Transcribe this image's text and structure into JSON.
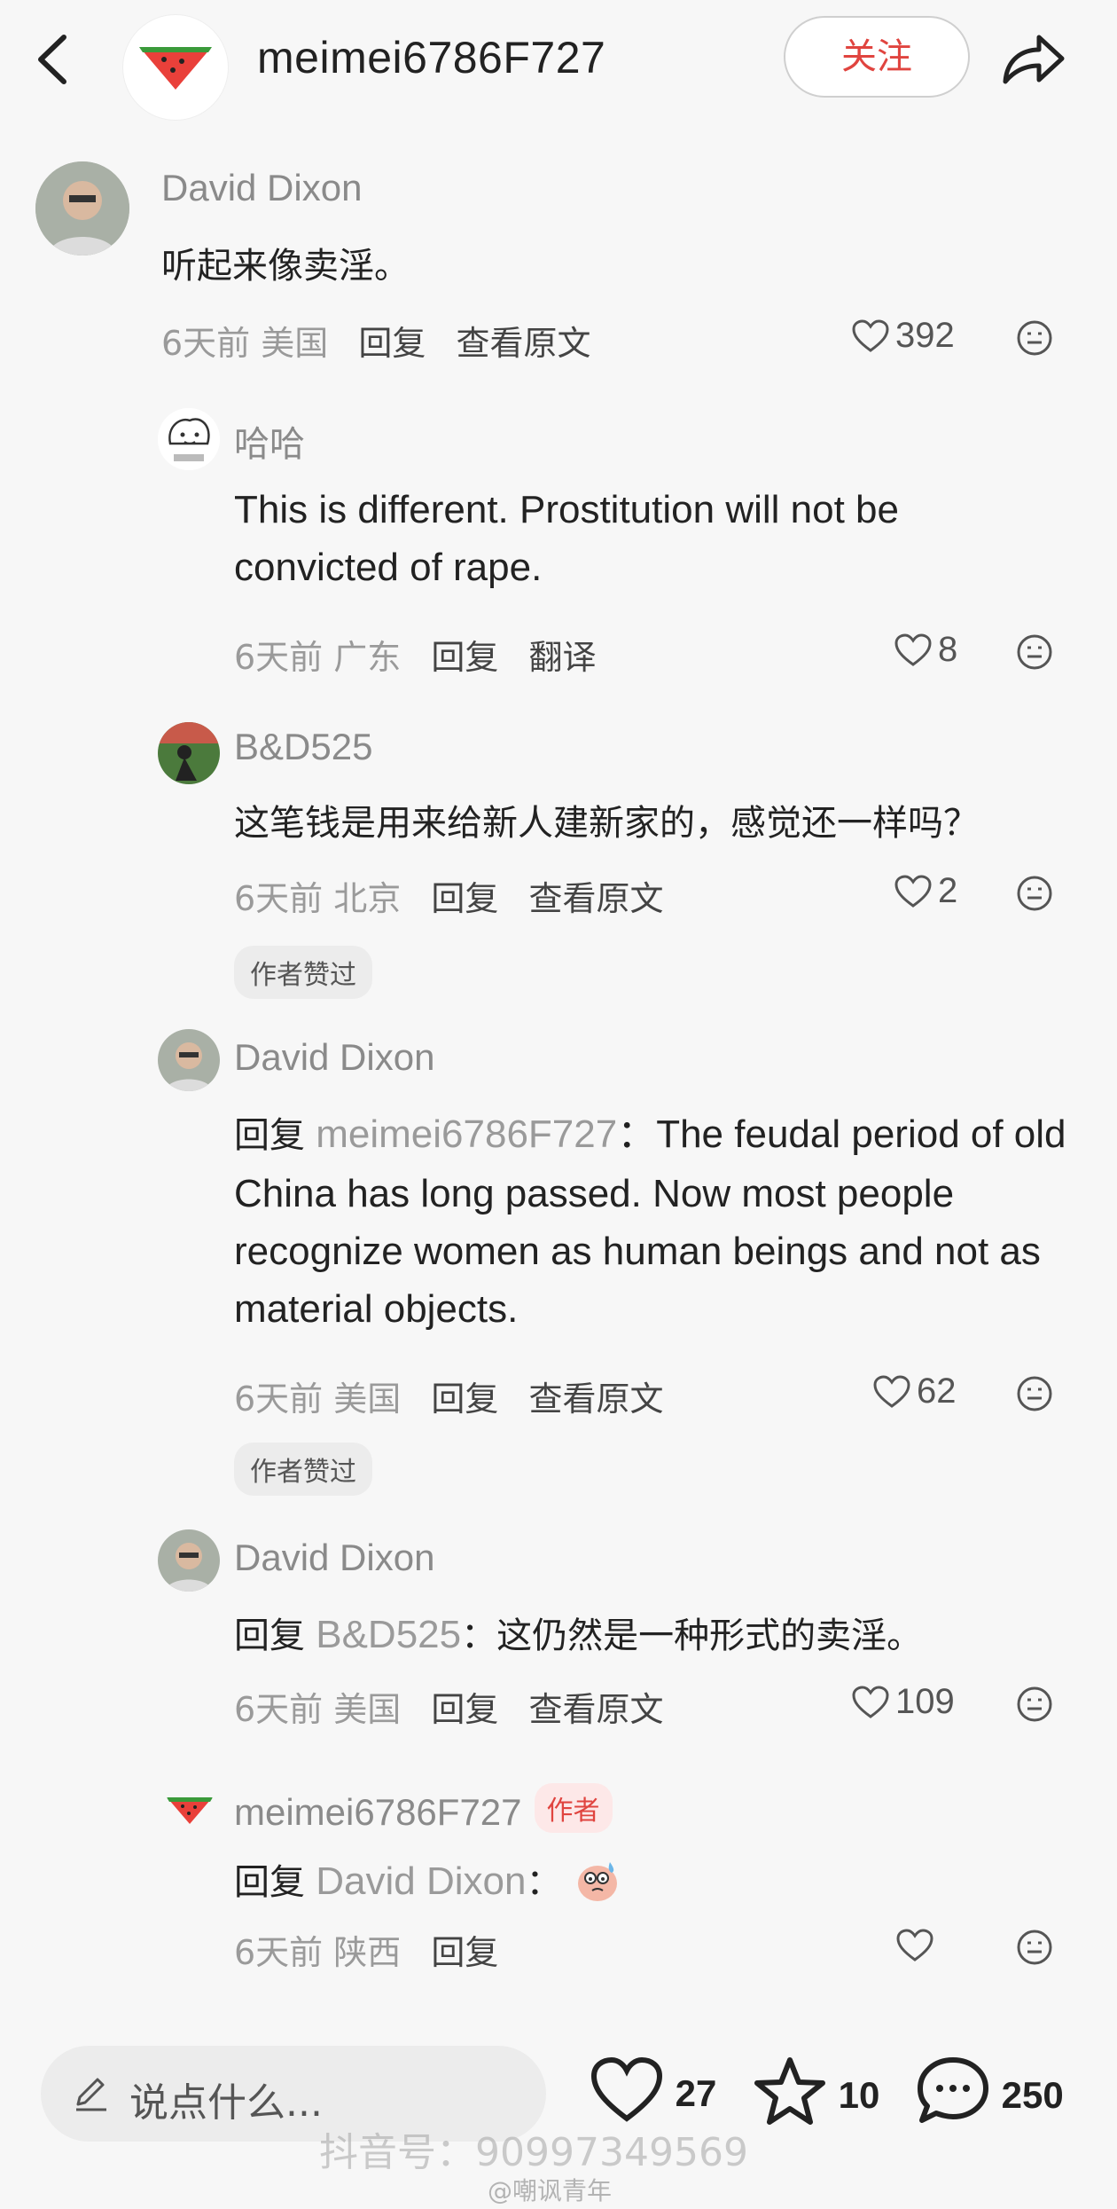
{
  "header": {
    "title": "meimei6786F727",
    "follow_label": "关注"
  },
  "comments": [
    {
      "user": "David Dixon",
      "text": "听起来像卖淫。",
      "time": "6天前",
      "location": "美国",
      "reply_label": "回复",
      "extra_label": "查看原文",
      "likes": "392"
    },
    {
      "user": "哈哈",
      "text": "This is different. Prostitution will not be convicted of rape.",
      "time": "6天前",
      "location": "广东",
      "reply_label": "回复",
      "extra_label": "翻译",
      "likes": "8"
    },
    {
      "user": "B&D525",
      "text": "这笔钱是用来给新人建新家的，感觉还一样吗？",
      "time": "6天前",
      "location": "北京",
      "reply_label": "回复",
      "extra_label": "查看原文",
      "likes": "2",
      "badge": "作者赞过"
    },
    {
      "user": "David Dixon",
      "reply_prefix": "回复",
      "reply_target": "meimei6786F727",
      "text": "：The feudal period of old China has long passed. Now most people recognize women as human beings and not as material objects.",
      "time": "6天前",
      "location": "美国",
      "reply_label": "回复",
      "extra_label": "查看原文",
      "likes": "62",
      "badge": "作者赞过"
    },
    {
      "user": "David Dixon",
      "reply_prefix": "回复",
      "reply_target": "B&D525",
      "text": "：这仍然是一种形式的卖淫。",
      "time": "6天前",
      "location": "美国",
      "reply_label": "回复",
      "extra_label": "查看原文",
      "likes": "109"
    },
    {
      "user": "meimei6786F727",
      "author_tag": "作者",
      "reply_prefix": "回复",
      "reply_target": "David Dixon",
      "text": "：",
      "time": "6天前",
      "location": "陕西",
      "reply_label": "回复",
      "likes": ""
    }
  ],
  "bottom_bar": {
    "input_placeholder": "说点什么...",
    "like_count": "27",
    "star_count": "10",
    "comment_count": "250"
  },
  "watermark": "抖音号：90997349569",
  "watermark2": "@嘲讽青年",
  "colors": {
    "accent_red": "#e0443f",
    "meta_gray": "#9a9a9a",
    "background": "#f7f7f7"
  },
  "icons": [
    "back-arrow-icon",
    "watermelon-icon",
    "share-icon",
    "heart-icon",
    "star-icon",
    "comment-icon",
    "pen-icon",
    "meh-face-icon"
  ]
}
